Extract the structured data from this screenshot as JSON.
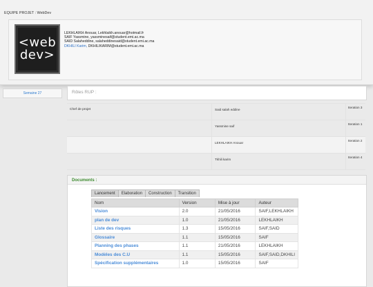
{
  "team": {
    "title": "EQUIPE PROJET : WebDev",
    "logo": {
      "line1": "<web",
      "line2": "dev>"
    },
    "members": [
      {
        "name": "LEKHLAIKH Anouar",
        "email": "Lekhlaikh.anouar@hotmail.fr"
      },
      {
        "name": "SAIF Yassmine",
        "email": "yassminesaif@student.emi.ac.ma"
      },
      {
        "name": "SAID Salaheddine",
        "email": "salaheddinesaid@student.emi.ac.ma"
      },
      {
        "name": "DKHILI Karim",
        "email": "DKHILIKARIM@student.emi.ac.ma"
      }
    ]
  },
  "sidebar": {
    "week": "Semaine 27"
  },
  "rup": {
    "title": "Rôles RUP :"
  },
  "roles": [
    {
      "role": "Chef de projet",
      "person": "Said salah eddine",
      "iteration": "Iteration 3"
    },
    {
      "role": "",
      "person": "Yassmine saif",
      "iteration": "Iteration 1"
    },
    {
      "role": "",
      "person": "LEKHLAIKH Anouar",
      "iteration": "Iteration 2"
    },
    {
      "role": "",
      "person": "Tkhili karim",
      "iteration": "Iteration 4"
    }
  ],
  "documents": {
    "title": "Documents :",
    "tabs": [
      "Lancement",
      "Elaboration",
      "Construction",
      "Transition"
    ],
    "columns": [
      "Nom",
      "Version",
      "Mise à jour",
      "Auteur"
    ],
    "rows": [
      {
        "name": "Vision",
        "version": "2.0",
        "date": "21/05/2016",
        "author": "SAIF,LEKHLAIKH"
      },
      {
        "name": "plan de dev",
        "version": "1.0",
        "date": "21/05/2016",
        "author": "LEKHLAIKH"
      },
      {
        "name": "Liste des risques",
        "version": "1.3",
        "date": "15/05/2016",
        "author": "SAIF,SAID"
      },
      {
        "name": "Glossaire",
        "version": "1.1",
        "date": "15/05/2016",
        "author": "SAIF"
      },
      {
        "name": "Planning des phases",
        "version": "1.1",
        "date": "21/05/2016",
        "author": "LEKHLAIKH"
      },
      {
        "name": "Modèles des C.U",
        "version": "1.1",
        "date": "15/05/2016",
        "author": "SAIF,SAID,DKHILI"
      },
      {
        "name": "Spécification supplémentaires",
        "version": "1.0",
        "date": "15/05/2016",
        "author": "SAIF"
      }
    ]
  }
}
